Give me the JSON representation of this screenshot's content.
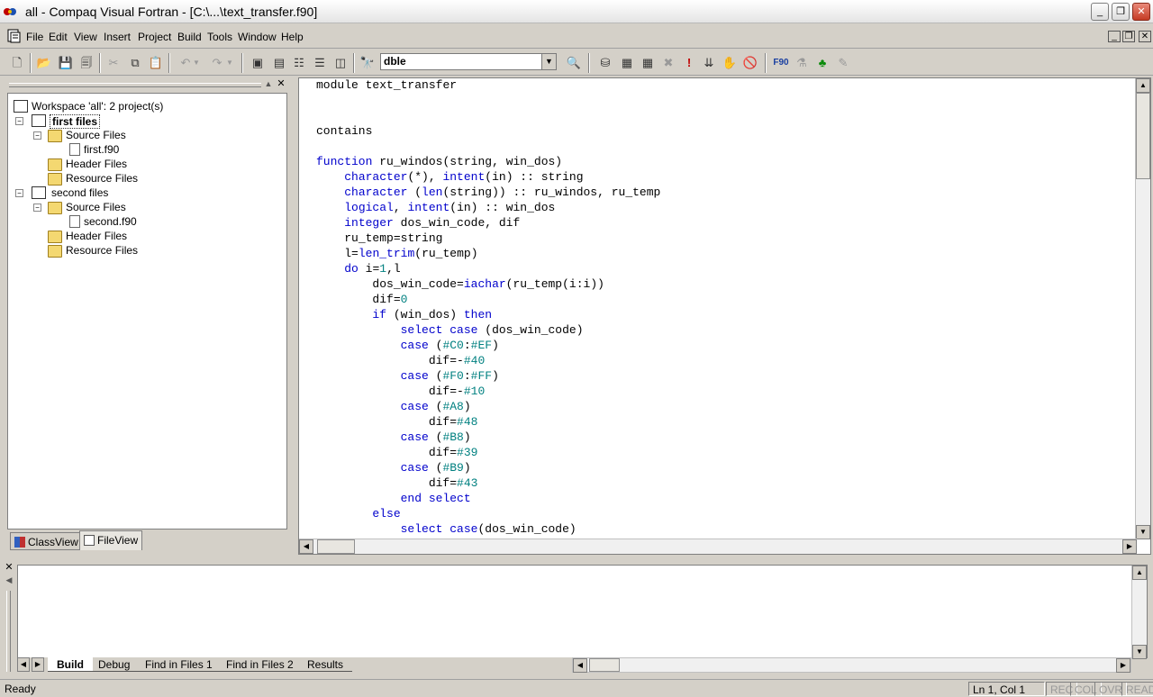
{
  "window": {
    "title": "all - Compaq Visual Fortran - [C:\\...\\text_transfer.f90]",
    "controls": {
      "minimize": "_",
      "maximize": "❐",
      "close": "✕"
    }
  },
  "menu": {
    "items": [
      "File",
      "Edit",
      "View",
      "Insert",
      "Project",
      "Build",
      "Tools",
      "Window",
      "Help"
    ]
  },
  "toolbar": {
    "find_combo_value": "dble"
  },
  "workspace": {
    "header": "Workspace 'all': 2 project(s)",
    "projects": [
      {
        "name": "first files",
        "bold": true,
        "folders": [
          {
            "name": "Source Files",
            "files": [
              "first.f90"
            ]
          },
          {
            "name": "Header Files",
            "files": []
          },
          {
            "name": "Resource Files",
            "files": []
          }
        ]
      },
      {
        "name": "second files",
        "bold": false,
        "folders": [
          {
            "name": "Source Files",
            "files": [
              "second.f90"
            ]
          },
          {
            "name": "Header Files",
            "files": []
          },
          {
            "name": "Resource Files",
            "files": []
          }
        ]
      }
    ],
    "tabs": [
      "ClassView",
      "FileView"
    ],
    "active_tab": "FileView"
  },
  "editor": {
    "lines": [
      "module text_transfer",
      "",
      "",
      "contains",
      "",
      "function ru_windos(string, win_dos)",
      "    character(*), intent(in) :: string",
      "    character (len(string)) :: ru_windos, ru_temp",
      "    logical, intent(in) :: win_dos",
      "    integer dos_win_code, dif",
      "    ru_temp=string",
      "    l=len_trim(ru_temp)",
      "    do i=1,l",
      "        dos_win_code=iachar(ru_temp(i:i))",
      "        dif=0",
      "        if (win_dos) then",
      "            select case (dos_win_code)",
      "            case (#C0:#EF)",
      "                dif=-#40",
      "            case (#F0:#FF)",
      "                dif=-#10",
      "            case (#A8)",
      "                dif=#48",
      "            case (#B8)",
      "                dif=#39",
      "            case (#B9)",
      "                dif=#43",
      "            end select",
      "        else",
      "            select case(dos_win_code)"
    ],
    "keywords": [
      "function",
      "character",
      "intent",
      "len",
      "logical",
      "integer",
      "len_trim",
      "do",
      "iachar",
      "if",
      "then",
      "select",
      "case",
      "end",
      "else"
    ]
  },
  "output": {
    "tabs": [
      "Build",
      "Debug",
      "Find in Files 1",
      "Find in Files 2",
      "Results"
    ],
    "active_tab": "Build"
  },
  "status": {
    "text": "Ready",
    "position": "Ln 1, Col 1",
    "indicators": [
      "REC",
      "COL",
      "OVR",
      "READ"
    ]
  }
}
